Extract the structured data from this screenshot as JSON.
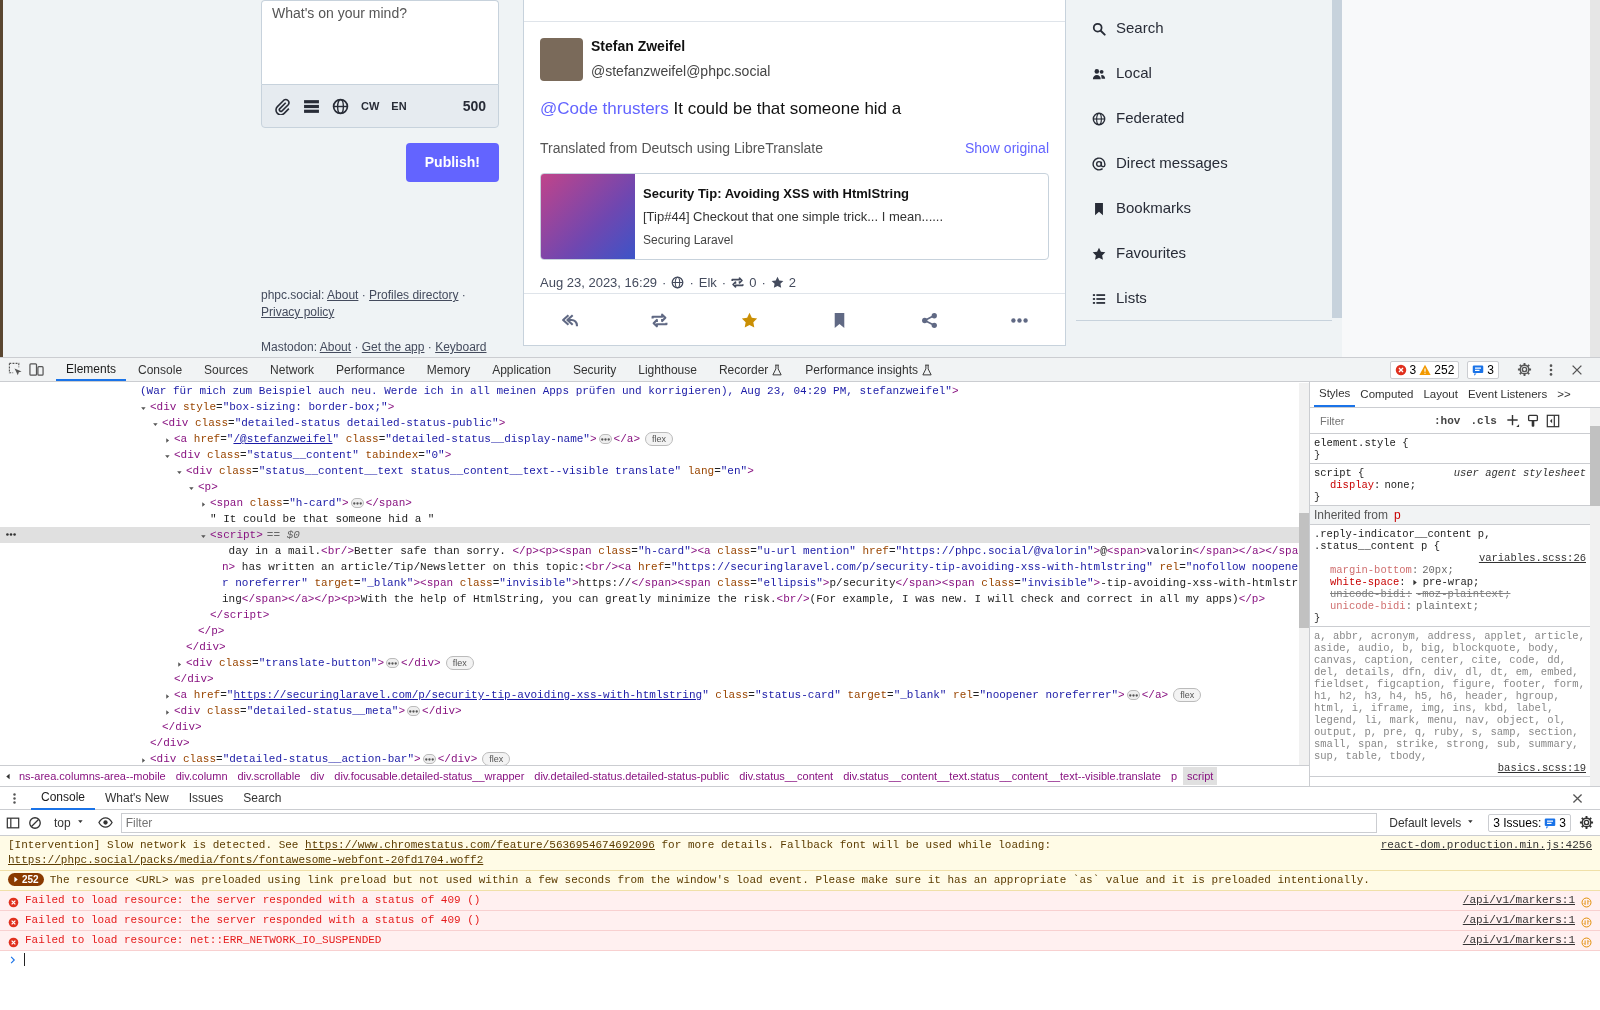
{
  "compose": {
    "placeholder": "What's on your mind?",
    "tools": [
      {
        "kind": "attach"
      },
      {
        "kind": "poll"
      },
      {
        "kind": "visibility"
      },
      {
        "kind": "cw",
        "label": "CW"
      },
      {
        "kind": "language",
        "label": "EN"
      }
    ],
    "char_count": "500",
    "publish": "Publish!"
  },
  "footer": {
    "separator": "·",
    "lines": [
      {
        "label": "phpc.social:",
        "links": [
          "About",
          "Profiles directory",
          "Privacy policy"
        ]
      },
      {
        "label": "Mastodon:",
        "links": [
          "About",
          "Get the app",
          "Keyboard"
        ]
      }
    ]
  },
  "status": {
    "name": "Stefan Zweifel",
    "handle": "@stefanzweifel@phpc.social",
    "mention": "@Code thrusters",
    "text": "It could be that someone hid a",
    "translation_note": "Translated from Deutsch using LibreTranslate",
    "show_original": "Show original",
    "card": {
      "title": "Security Tip: Avoiding XSS with HtmlString",
      "description": "[Tip#44] Checkout that one simple trick... I mean......",
      "source": "Securing Laravel"
    },
    "meta": {
      "date": "Aug 23, 2023, 16:29",
      "separator": "·",
      "app": "Elk",
      "boosts": "0",
      "favourites": "2"
    },
    "actions": [
      {
        "kind": "reply",
        "active": false
      },
      {
        "kind": "boost",
        "active": false
      },
      {
        "kind": "favourite",
        "active": true
      },
      {
        "kind": "bookmark",
        "active": false
      },
      {
        "kind": "share",
        "active": false
      },
      {
        "kind": "more",
        "active": false
      }
    ]
  },
  "nav": [
    {
      "kind": "search",
      "label": "Search"
    },
    {
      "kind": "local",
      "label": "Local"
    },
    {
      "kind": "federated",
      "label": "Federated"
    },
    {
      "kind": "direct",
      "label": "Direct messages"
    },
    {
      "kind": "bookmarks",
      "label": "Bookmarks"
    },
    {
      "kind": "favourites",
      "label": "Favourites"
    },
    {
      "kind": "lists",
      "label": "Lists"
    }
  ],
  "devtools": {
    "tabs": [
      {
        "label": "Elements",
        "selected": true,
        "experimental": false
      },
      {
        "label": "Console",
        "selected": false,
        "experimental": false
      },
      {
        "label": "Sources",
        "selected": false,
        "experimental": false
      },
      {
        "label": "Network",
        "selected": false,
        "experimental": false
      },
      {
        "label": "Performance",
        "selected": false,
        "experimental": false
      },
      {
        "label": "Memory",
        "selected": false,
        "experimental": false
      },
      {
        "label": "Application",
        "selected": false,
        "experimental": false
      },
      {
        "label": "Security",
        "selected": false,
        "experimental": false
      },
      {
        "label": "Lighthouse",
        "selected": false,
        "experimental": false
      },
      {
        "label": "Recorder",
        "selected": false,
        "experimental": true
      },
      {
        "label": "Performance insights",
        "selected": false,
        "experimental": true
      }
    ],
    "errors": "3",
    "warnings": "252",
    "issues": "3",
    "dom_tree": [
      {
        "kind": "tail",
        "text": "(War für mich zum Beispiel auch neu. Werde ich in all meinen Apps prüfen und korrigieren), Aug 23, 04:29 PM, stefanzweifel\">",
        "selected": false
      },
      {
        "kind": "element",
        "open": "<div style=\"box-sizing: border-box;\">",
        "expanded": true,
        "selected": false,
        "close": "</div>",
        "children": [
          {
            "kind": "element",
            "open": "<div class=\"detailed-status detailed-status-public\">",
            "expanded": true,
            "selected": false,
            "close": "</div>",
            "children": [
              {
                "kind": "element",
                "open": "<a href=\"/@stefanzweifel\" class=\"detailed-status__display-name\">",
                "expanded": false,
                "selected": false,
                "close": "</a>",
                "badge": "flex"
              },
              {
                "kind": "element",
                "open": "<div class=\"status__content\" tabindex=\"0\">",
                "expanded": true,
                "selected": false,
                "close": "</div>",
                "children": [
                  {
                    "kind": "element",
                    "open": "<div class=\"status__content__text status__content__text--visible translate\" lang=\"en\">",
                    "expanded": true,
                    "selected": false,
                    "close": "</div>",
                    "children": [
                      {
                        "kind": "element",
                        "open": "<p>",
                        "expanded": true,
                        "selected": false,
                        "close": "</p>",
                        "children": [
                          {
                            "kind": "element",
                            "open": "<span class=\"h-card\">",
                            "expanded": false,
                            "selected": false,
                            "close": "</span>"
                          },
                          {
                            "kind": "text",
                            "text": "\" It could be that someone hid a \"",
                            "selected": false
                          },
                          {
                            "kind": "element",
                            "open": "<script>",
                            "suffix": "== $0",
                            "expanded": true,
                            "selected": true,
                            "close": "</script>",
                            "children": [
                              {
                                "kind": "script",
                                "text": " day in a mail.<br/>Better safe than sorry. </p><p><span class=\"h-card\"><a class=\"u-url mention\" href=\"https://phpc.social/@valorin\">@<span>valorin</span></a></span> has written an article/Tip/Newsletter on this topic:<br/><a href=\"https://securinglaravel.com/p/security-tip-avoiding-xss-with-htmlstring\" rel=\"nofollow noopener noreferrer\" target=\"_blank\"><span class=\"invisible\">https://</span><span class=\"ellipsis\">p/security</span><span class=\"invisible\">-tip-avoiding-xss-with-htmlstring</span></a></p><p>With the help of HtmlString, you can greatly minimize the risk.<br/>(For example, I was new. I will check and correct in all my apps)</p>",
                                "selected": false
                              }
                            ]
                          }
                        ]
                      }
                    ]
                  },
                  {
                    "kind": "element",
                    "open": "<div class=\"translate-button\">",
                    "expanded": false,
                    "selected": false,
                    "close": "</div>",
                    "badge": "flex"
                  }
                ]
              },
              {
                "kind": "element",
                "open": "<a href=\"https://securinglaravel.com/p/security-tip-avoiding-xss-with-htmlstring\" class=\"status-card\" target=\"_blank\" rel=\"noopener noreferrer\">",
                "expanded": false,
                "selected": false,
                "close": "</a>",
                "badge": "flex"
              },
              {
                "kind": "element",
                "open": "<div class=\"detailed-status__meta\">",
                "expanded": false,
                "selected": false,
                "close": "</div>"
              }
            ]
          }
        ]
      },
      {
        "kind": "element",
        "open": "<div class=\"detailed-status__action-bar\">",
        "expanded": false,
        "selected": false,
        "close": "</div>",
        "badge": "flex"
      }
    ],
    "breadcrumbs": [
      {
        "label": "ns-area.columns-area--mobile",
        "selected": false
      },
      {
        "label": "div.column",
        "selected": false
      },
      {
        "label": "div.scrollable",
        "selected": false
      },
      {
        "label": "div",
        "selected": false
      },
      {
        "label": "div.focusable.detailed-status__wrapper",
        "selected": false
      },
      {
        "label": "div.detailed-status.detailed-status-public",
        "selected": false
      },
      {
        "label": "div.status__content",
        "selected": false
      },
      {
        "label": "div.status__content__text.status__content__text--visible.translate",
        "selected": false
      },
      {
        "label": "p",
        "selected": false
      },
      {
        "label": "script",
        "selected": true
      }
    ],
    "styles": {
      "tabs": [
        {
          "label": "Styles",
          "selected": true
        },
        {
          "label": "Computed",
          "selected": false
        },
        {
          "label": "Layout",
          "selected": false
        },
        {
          "label": "Event Listeners",
          "selected": false
        }
      ],
      "more_tabs": ">>",
      "filter_placeholder": "Filter",
      "hov": ":hov",
      "cls": ".cls",
      "rules": [
        {
          "kind": "rule",
          "selector": "element.style {",
          "matched": true,
          "close": "}"
        },
        {
          "kind": "rule",
          "selector": "script {",
          "source": "user agent stylesheet",
          "user_agent": true,
          "matched": true,
          "props": [
            {
              "kind": "active",
              "name": "display",
              "separator": ":",
              "value": "none;"
            }
          ],
          "close": "}"
        },
        {
          "kind": "inherited",
          "label": "Inherited from",
          "tag": "p"
        },
        {
          "kind": "rule",
          "selector": ".reply-indicator__content p, .status__content p {",
          "source": "variables.scss:26",
          "user_agent": false,
          "matched": true,
          "props": [
            {
              "kind": "inactive",
              "name": "margin-bottom",
              "separator": ":",
              "value": "20px;"
            },
            {
              "kind": "active",
              "name": "white-space",
              "separator": ":",
              "value": "pre-wrap;",
              "expandable": true
            },
            {
              "kind": "overridden",
              "name": "unicode-bidi",
              "separator": ":",
              "value": "-moz-plaintext;"
            },
            {
              "kind": "inactive",
              "name": "unicode-bidi",
              "separator": ":",
              "value": "plaintext;"
            }
          ],
          "close": "}"
        },
        {
          "kind": "rule",
          "selector": "a, abbr, acronym, address, applet, article, aside, audio, b, big, blockquote, body, canvas, caption, center, cite, code, dd, del, details, dfn, div, dl, dt, em, embed, fieldset, figcaption, figure, footer, form, h1, h2, h3, h4, h5, h6, header, hgroup, html, i, iframe, img, ins, kbd, label, legend, li, mark, menu, nav, object, ol, output, p, pre, q, ruby, s, samp, section, small, span, strike, strong, sub, summary, sup, table, tbody,",
          "source": "basics.scss:19",
          "user_agent": false,
          "matched": false
        }
      ]
    },
    "drawer_tabs": [
      {
        "label": "Console",
        "selected": true
      },
      {
        "label": "What's New",
        "selected": false
      },
      {
        "label": "Issues",
        "selected": false
      },
      {
        "label": "Search",
        "selected": false
      }
    ],
    "console_toolbar": {
      "context": "top",
      "filter_placeholder": "Filter",
      "levels": "Default levels",
      "issues_label": "3 Issues:",
      "issues_count": "3"
    },
    "messages": [
      {
        "kind": "intervention",
        "parts": [
          {
            "kind": "text",
            "text": "[Intervention] Slow network is detected. See "
          },
          {
            "kind": "link",
            "text": "https://www.chromestatus.com/feature/5636954674692096"
          },
          {
            "kind": "text",
            "text": " for more details. Fallback font will be used while loading: "
          },
          {
            "kind": "link",
            "text": "https://phpc.social/packs/media/fonts/fontawesome-webfont-20fd1704.woff2"
          }
        ],
        "source": "react-dom.production.min.js:4256"
      },
      {
        "kind": "warning",
        "count": "252",
        "parts": [
          {
            "kind": "text",
            "text": "The resource <URL> was preloaded using link preload but not used within a few seconds from the window's load event. Please make sure it has an appropriate `as` value and it is preloaded intentionally."
          }
        ]
      },
      {
        "kind": "error",
        "parts": [
          {
            "kind": "text",
            "text": "Failed to load resource: the server responded with a status of 409 ()"
          }
        ],
        "source": "/api/v1/markers:1"
      },
      {
        "kind": "error",
        "parts": [
          {
            "kind": "text",
            "text": "Failed to load resource: the server responded with a status of 409 ()"
          }
        ],
        "source": "/api/v1/markers:1"
      },
      {
        "kind": "error",
        "parts": [
          {
            "kind": "text",
            "text": "Failed to load resource: net::ERR_NETWORK_IO_SUSPENDED"
          }
        ],
        "source": "/api/v1/markers:1"
      }
    ]
  }
}
